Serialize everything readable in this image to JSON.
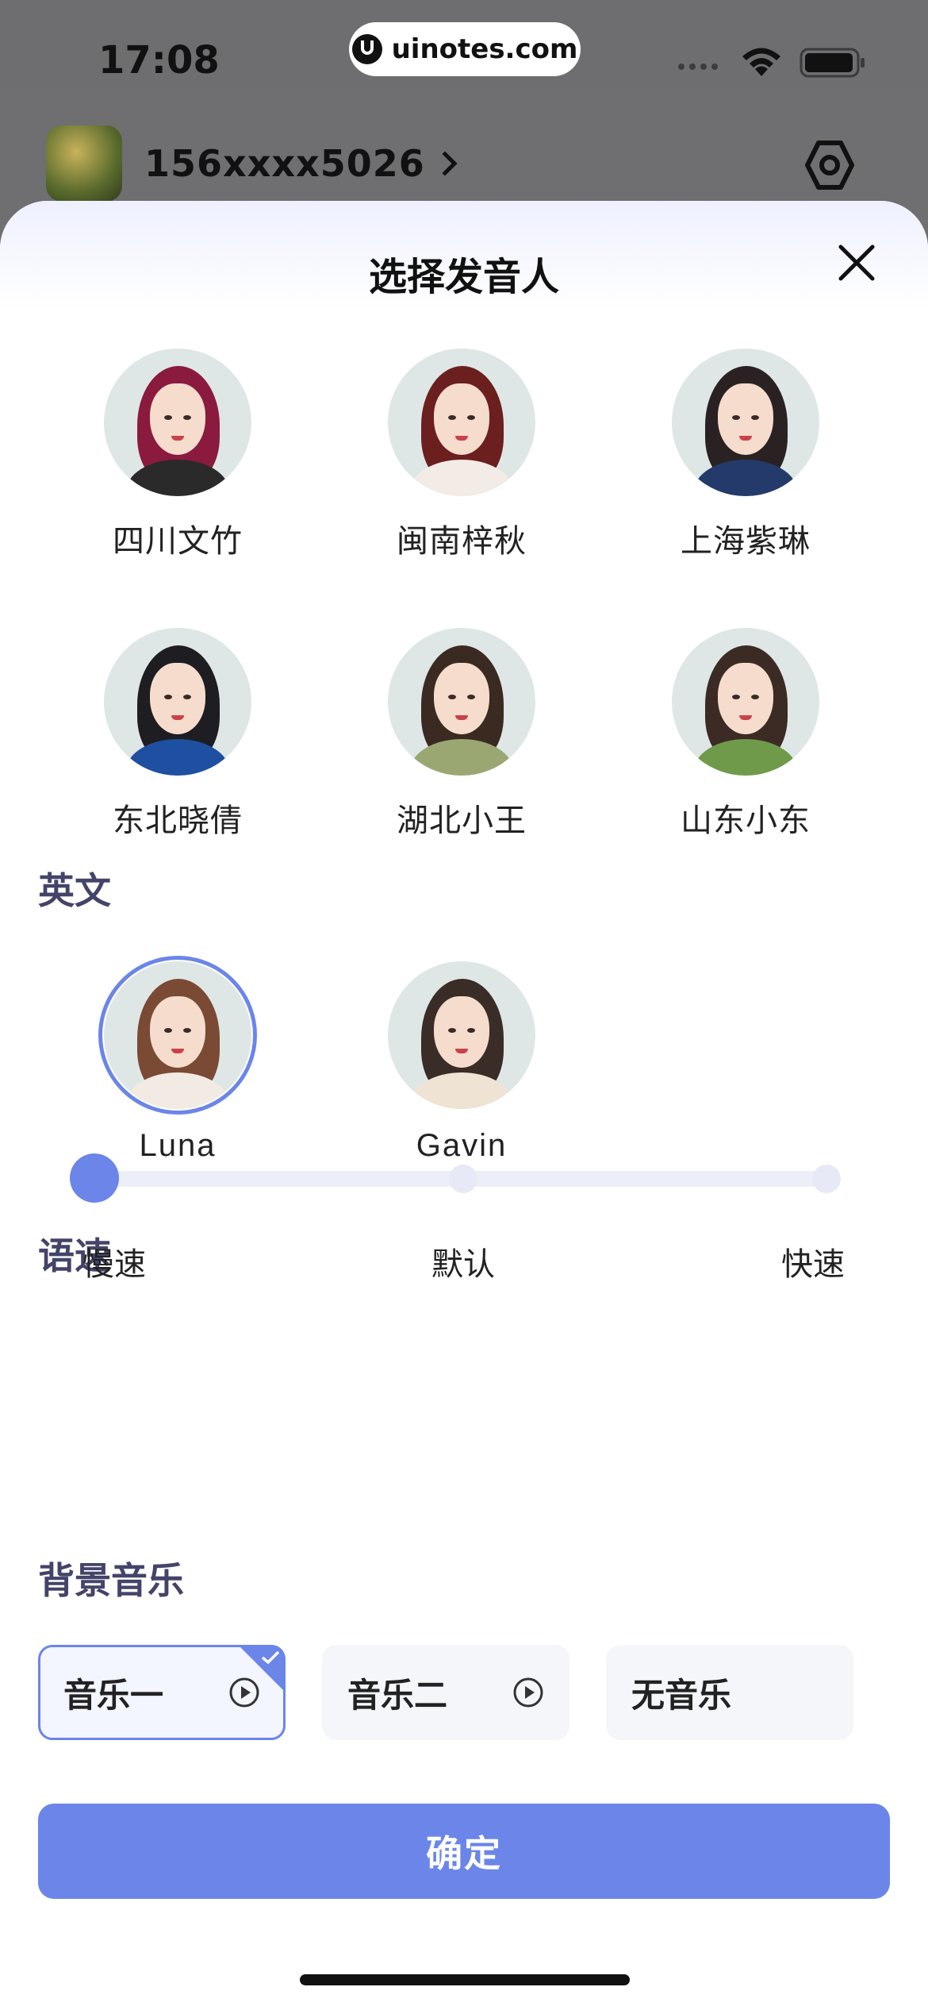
{
  "status_bar": {
    "time": "17:08",
    "url": "uinotes.com"
  },
  "header": {
    "username": "156xxxx5026"
  },
  "sheet": {
    "title": "选择发音人",
    "chinese_voices": [
      {
        "name": "四川文竹",
        "hair": "#8a1a3e",
        "top": "#2a2a2a"
      },
      {
        "name": "闽南梓秋",
        "hair": "#6b1f1f",
        "top": "#f3ece6"
      },
      {
        "name": "上海紫琳",
        "hair": "#2a2222",
        "top": "#243a6a"
      },
      {
        "name": "东北晓倩",
        "hair": "#1d1d22",
        "top": "#1f4fa0"
      },
      {
        "name": "湖北小王",
        "hair": "#3a2a22",
        "top": "#9aa772"
      },
      {
        "name": "山东小东",
        "hair": "#3b2b24",
        "top": "#6f9a4a"
      }
    ],
    "english_label": "英文",
    "english_voices": [
      {
        "name": "Luna",
        "hair": "#7a4a34",
        "top": "#f1ebe4",
        "selected": true
      },
      {
        "name": "Gavin",
        "hair": "#3a2c26",
        "top": "#efe3d4",
        "selected": false
      }
    ],
    "speed_label": "语速",
    "speed": {
      "options": [
        "慢速",
        "默认",
        "快速"
      ],
      "selected_index": 0
    },
    "music_label": "背景音乐",
    "music_options": [
      {
        "label": "音乐一",
        "has_play": true,
        "selected": true
      },
      {
        "label": "音乐二",
        "has_play": true,
        "selected": false
      },
      {
        "label": "无音乐",
        "has_play": false,
        "selected": false
      }
    ],
    "confirm_label": "确定"
  },
  "colors": {
    "accent": "#6b85e8",
    "section_text": "#44446a"
  }
}
